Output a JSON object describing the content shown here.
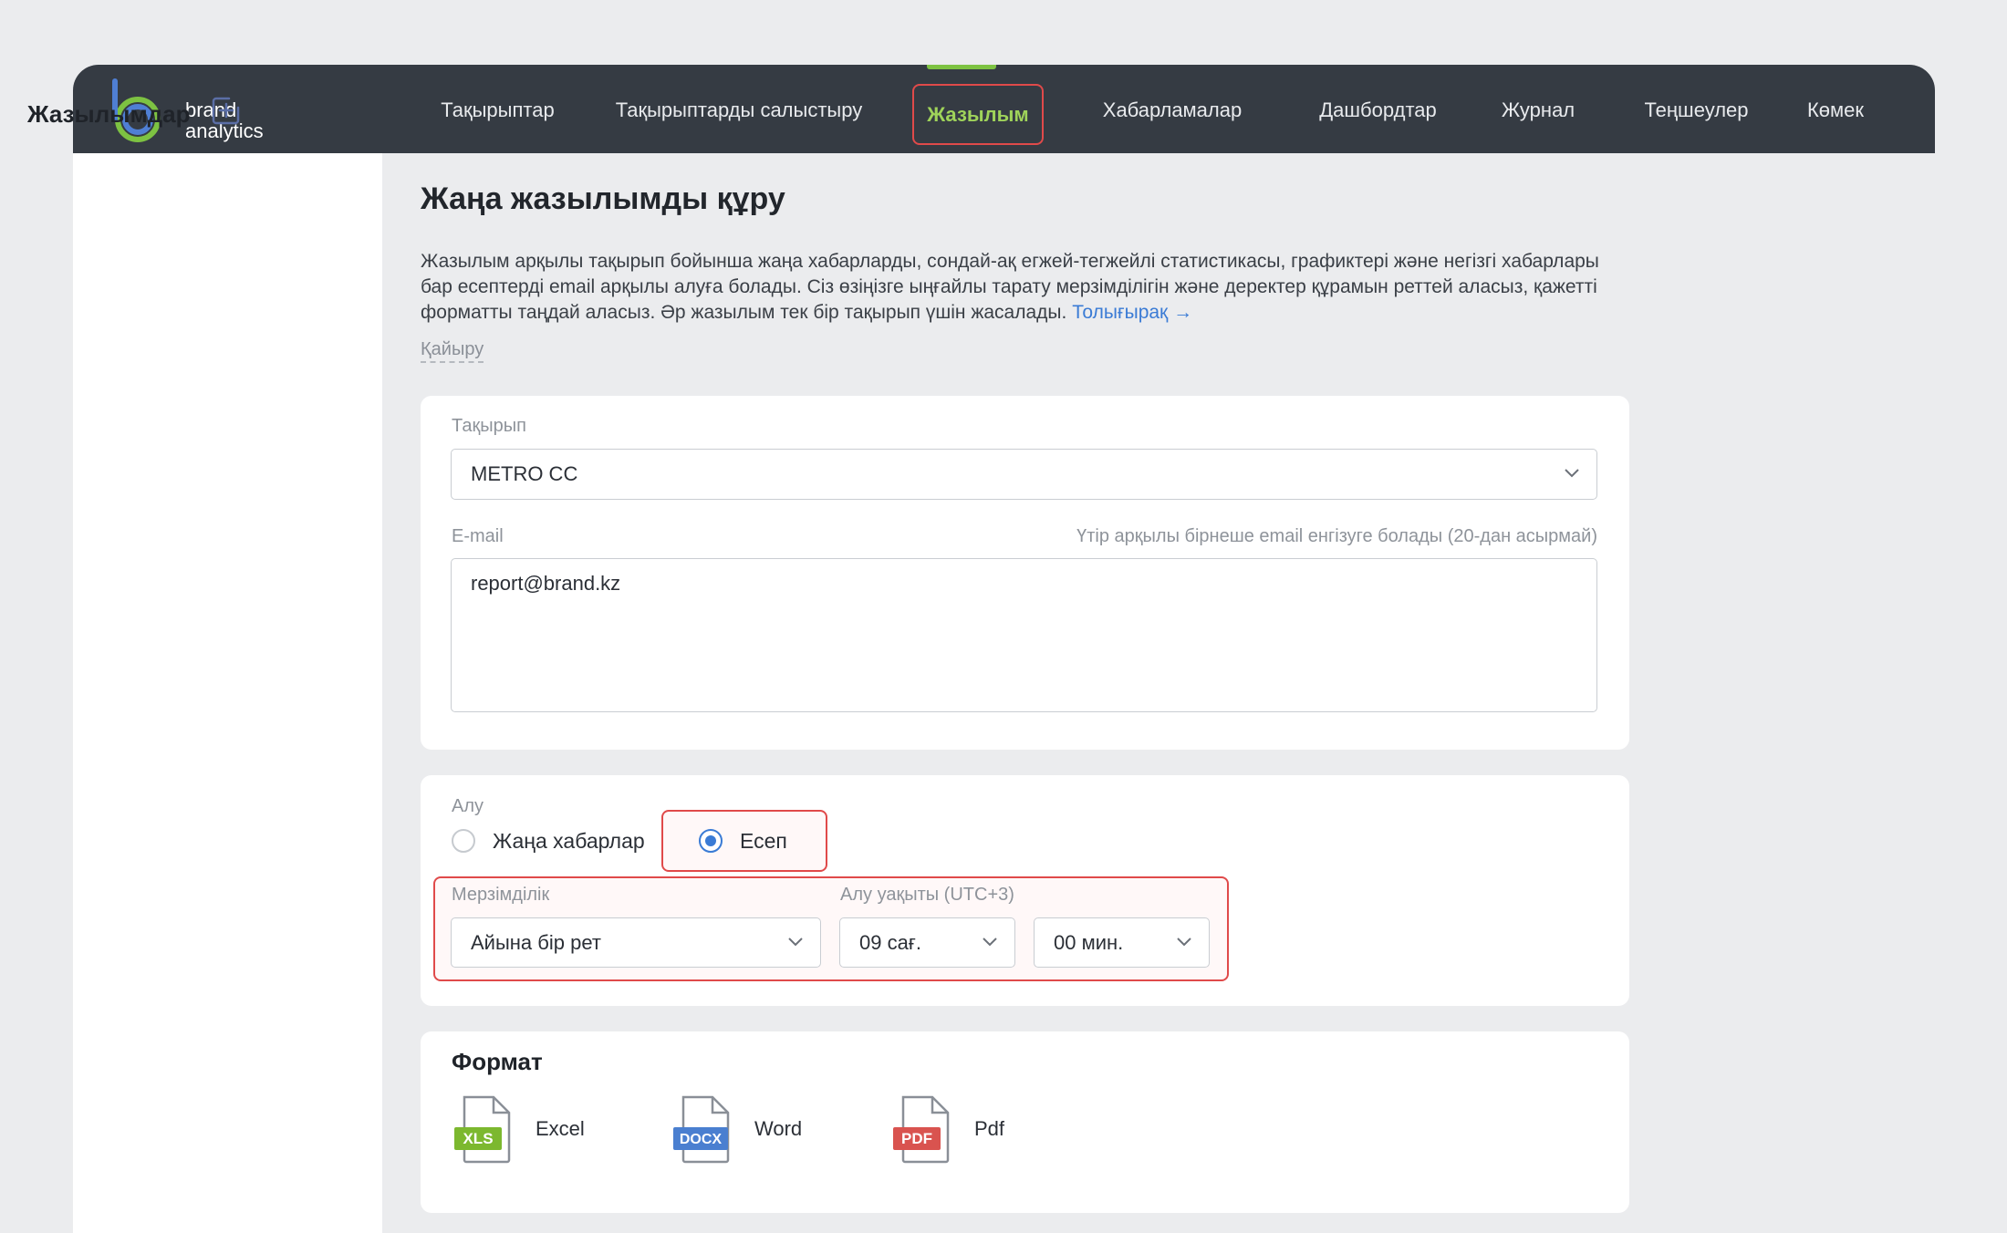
{
  "brand": {
    "line1": "brand",
    "line2": "analytics"
  },
  "nav": {
    "items": [
      {
        "label": "Тақырыптар"
      },
      {
        "label": "Тақырыптарды салыстыру"
      },
      {
        "label": "Жазылым"
      },
      {
        "label": "Хабарламалар"
      },
      {
        "label": "Дашбордтар"
      },
      {
        "label": "Журнал"
      },
      {
        "label": "Теңшеулер"
      },
      {
        "label": "Көмек"
      }
    ],
    "active": "Жазылым"
  },
  "sidebar": {
    "title": "Жазылымдар",
    "add_icon": "add-square-icon"
  },
  "page": {
    "title": "Жаңа жазылымды құру",
    "description": "Жазылым арқылы тақырып бойынша жаңа хабарларды, сондай-ақ егжей-тегжейлі статистикасы, графиктері және негізгі хабарлары бар есептерді email арқылы алуға болады. Сіз өзіңізге ыңғайлы тарату мерзімділігін және деректер құрамын реттей аласыз, қажетті форматты таңдай аласыз. Әр жазылым тек бір тақырып үшін жасалады.",
    "more_link": "Толығырақ →",
    "back": "Қайыру"
  },
  "form": {
    "topic_label": "Тақырып",
    "topic_value": "METRO CC",
    "email_label": "E-mail",
    "email_hint": "Үтір арқылы бірнеше email енгізуге болады (20-дан асырмай)",
    "email_value": "report@brand.kz",
    "receive_label": "Алу",
    "receive_options": [
      "Жаңа хабарлар",
      "Есеп"
    ],
    "receive_selected": "Есеп",
    "period_label": "Мерзімділік",
    "period_value": "Айына бір рет",
    "time_label": "Алу уақыты (UTC+3)",
    "hour_value": "09 сағ.",
    "minute_value": "00 мин.",
    "format_title": "Формат",
    "formats": [
      {
        "label": "Excel",
        "badge": "XLS",
        "color": "#7cb82f"
      },
      {
        "label": "Word",
        "badge": "DOCX",
        "color": "#4a7fd0"
      },
      {
        "label": "Pdf",
        "badge": "PDF",
        "color": "#d9534f"
      }
    ]
  }
}
